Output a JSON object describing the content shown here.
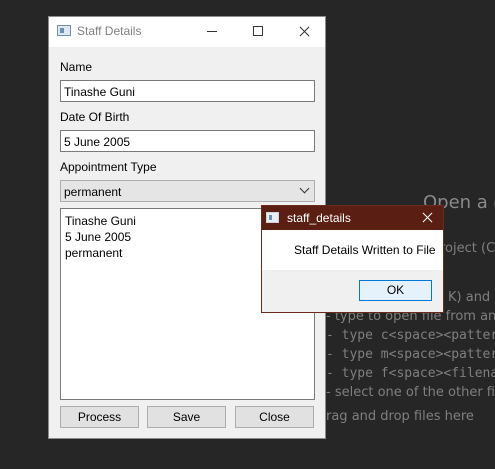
{
  "background": {
    "title": "Open a c",
    "lines": [
      "roject (C",
      "K) and",
      "- type to open file from any",
      "- type c<space><pattern",
      "- type m<space><pattern",
      "- type f<space><filenam",
      "- select one of the other filte",
      "rag and drop files here"
    ]
  },
  "window": {
    "title": "Staff Details",
    "name_label": "Name",
    "name_value": "Tinashe Guni",
    "dob_label": "Date Of Birth",
    "dob_value": "5 June 2005",
    "appt_label": "Appointment Type",
    "appt_value": "permanent",
    "output_lines": [
      "Tinashe Guni",
      "5 June 2005",
      "permanent"
    ],
    "buttons": {
      "process": "Process",
      "save": "Save",
      "close": "Close"
    }
  },
  "dialog": {
    "title": "staff_details",
    "message": "Staff Details Written to File",
    "ok": "OK"
  }
}
